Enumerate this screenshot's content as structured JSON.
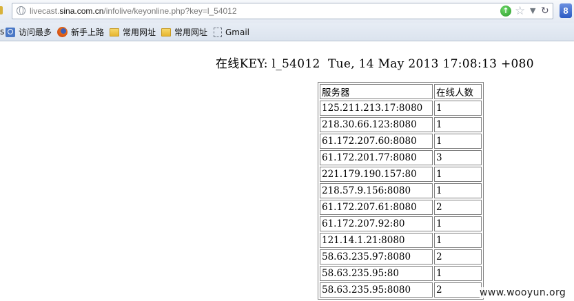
{
  "browser": {
    "url_domain_prefix": "livecast.",
    "url_domain": "sina.com.cn",
    "url_path": "/infolive/keyonline.php?key=l_54012",
    "google_label": "8"
  },
  "bookmarks": {
    "lead": "s",
    "items": [
      {
        "label": "访问最多",
        "icon": "search-page-icon"
      },
      {
        "label": "新手上路",
        "icon": "firefox-icon"
      },
      {
        "label": "常用网址",
        "icon": "folder-icon"
      },
      {
        "label": "常用网址",
        "icon": "folder-icon"
      },
      {
        "label": "Gmail",
        "icon": "page-icon"
      }
    ]
  },
  "page": {
    "heading": "在线KEY: l_54012  Tue, 14 May 2013 17:08:13 +080",
    "table": {
      "headers": [
        "服务器",
        "在线人数"
      ],
      "rows": [
        [
          "125.211.213.17:8080",
          "1"
        ],
        [
          "218.30.66.123:8080",
          "1"
        ],
        [
          "61.172.207.60:8080",
          "1"
        ],
        [
          "61.172.201.77:8080",
          "3"
        ],
        [
          "221.179.190.157:80",
          "1"
        ],
        [
          "218.57.9.156:8080",
          "1"
        ],
        [
          "61.172.207.61:8080",
          "2"
        ],
        [
          "61.172.207.92:80",
          "1"
        ],
        [
          "121.14.1.21:8080",
          "1"
        ],
        [
          "58.63.235.97:8080",
          "2"
        ],
        [
          "58.63.235.95:80",
          "1"
        ],
        [
          "58.63.235.95:8080",
          "2"
        ]
      ]
    }
  },
  "watermark": "www.wooyun.org"
}
